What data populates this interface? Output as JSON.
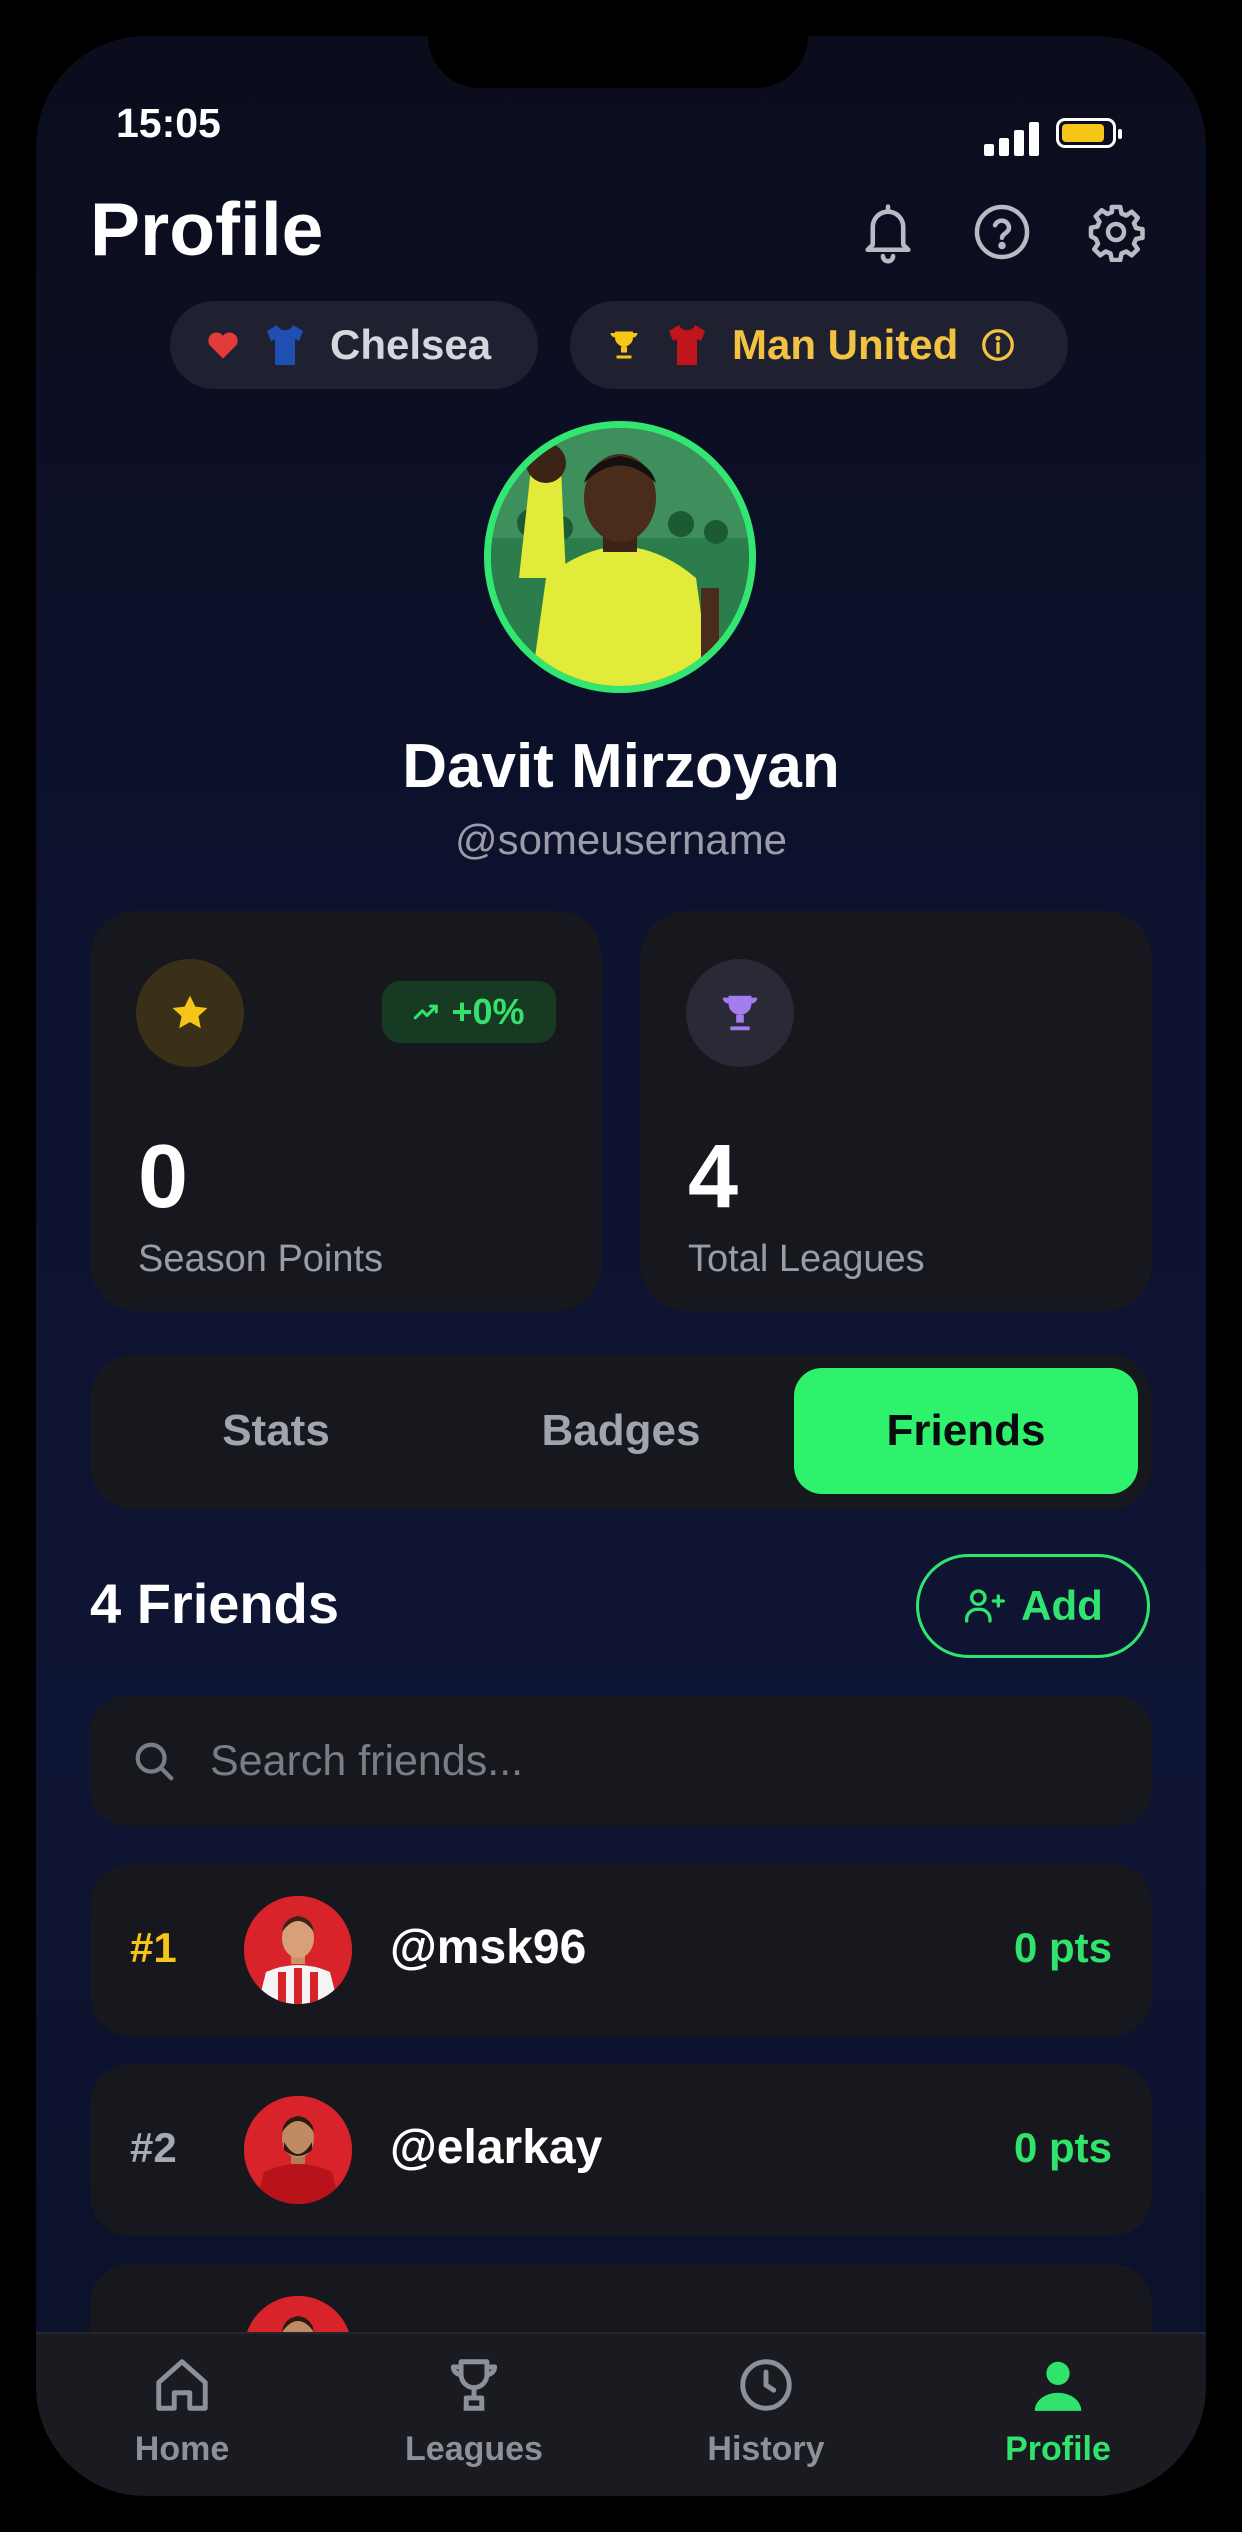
{
  "status": {
    "time": "15:05"
  },
  "header": {
    "title": "Profile"
  },
  "clubs": {
    "favorite": {
      "name": "Chelsea"
    },
    "rival": {
      "name": "Man United"
    }
  },
  "profile": {
    "name": "Davit Mirzoyan",
    "username": "@someusername"
  },
  "stats_cards": [
    {
      "value": "0",
      "label": "Season Points",
      "trend": "+0%"
    },
    {
      "value": "4",
      "label": "Total Leagues"
    }
  ],
  "tabs": [
    {
      "label": "Stats",
      "active": false
    },
    {
      "label": "Badges",
      "active": false
    },
    {
      "label": "Friends",
      "active": true
    }
  ],
  "friends": {
    "title": "4 Friends",
    "add_label": "Add",
    "search_placeholder": "Search friends...",
    "list": [
      {
        "rank": "#1",
        "handle": "@msk96",
        "points": "0 pts",
        "rank_color": "#f5c518"
      },
      {
        "rank": "#2",
        "handle": "@elarkay",
        "points": "0 pts",
        "rank_color": "#a6a8b2"
      }
    ]
  },
  "nav": [
    {
      "label": "Home",
      "icon": "home-icon"
    },
    {
      "label": "Leagues",
      "icon": "trophy-icon"
    },
    {
      "label": "History",
      "icon": "clock-icon"
    },
    {
      "label": "Profile",
      "icon": "user-icon",
      "active": true
    }
  ],
  "colors": {
    "accent": "#2ff26c",
    "gold": "#f5c518",
    "background": "#0d1230",
    "card": "#17181d"
  }
}
